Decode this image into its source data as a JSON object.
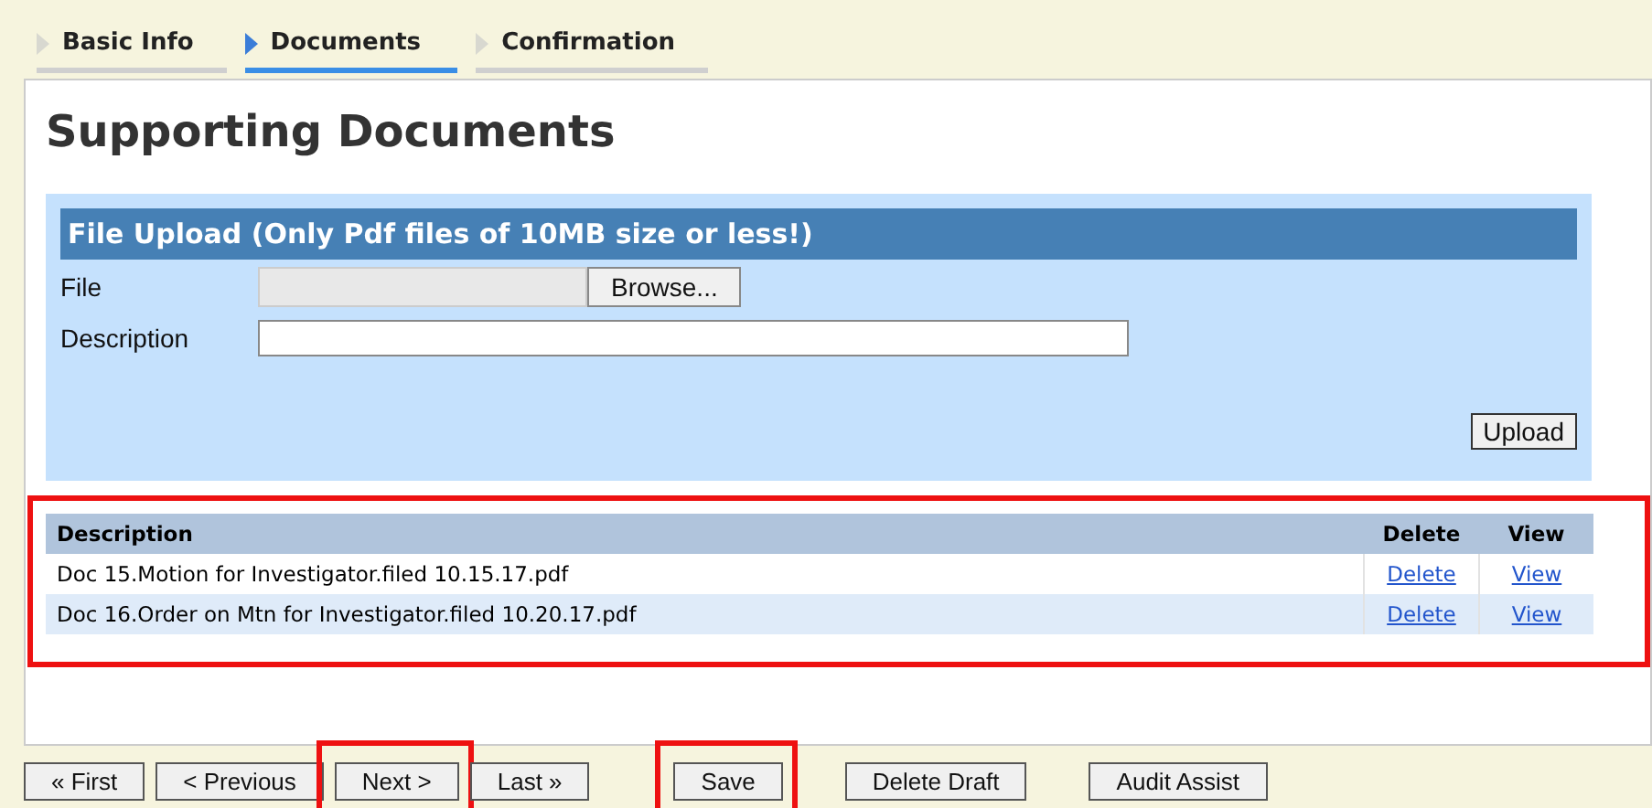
{
  "tabs": [
    {
      "label": "Basic Info",
      "selected": false
    },
    {
      "label": "Documents",
      "selected": true
    },
    {
      "label": "Confirmation",
      "selected": false
    }
  ],
  "title": "Supporting Documents",
  "upload": {
    "heading": "File Upload (Only Pdf files of 10MB size or less!)",
    "file_label": "File",
    "browse": "Browse...",
    "description_label": "Description",
    "upload_button": "Upload"
  },
  "table": {
    "highlighted": true,
    "columns": [
      "Description",
      "Delete",
      "View"
    ],
    "rows": [
      {
        "description": "Doc 15.Motion for Investigator.filed 10.15.17.pdf",
        "delete": "Delete",
        "view": "View"
      },
      {
        "description": "Doc 16.Order on Mtn for Investigator.filed 10.20.17.pdf",
        "delete": "Delete",
        "view": "View"
      }
    ]
  },
  "buttons": [
    {
      "label": "« First",
      "highlighted": false
    },
    {
      "label": "< Previous",
      "highlighted": false
    },
    {
      "label": "Next >",
      "highlighted": true
    },
    {
      "label": "Last »",
      "highlighted": false
    },
    {
      "label": "Save",
      "highlighted": true
    },
    {
      "label": "Delete Draft",
      "highlighted": false
    },
    {
      "label": "Audit Assist",
      "highlighted": false
    }
  ]
}
